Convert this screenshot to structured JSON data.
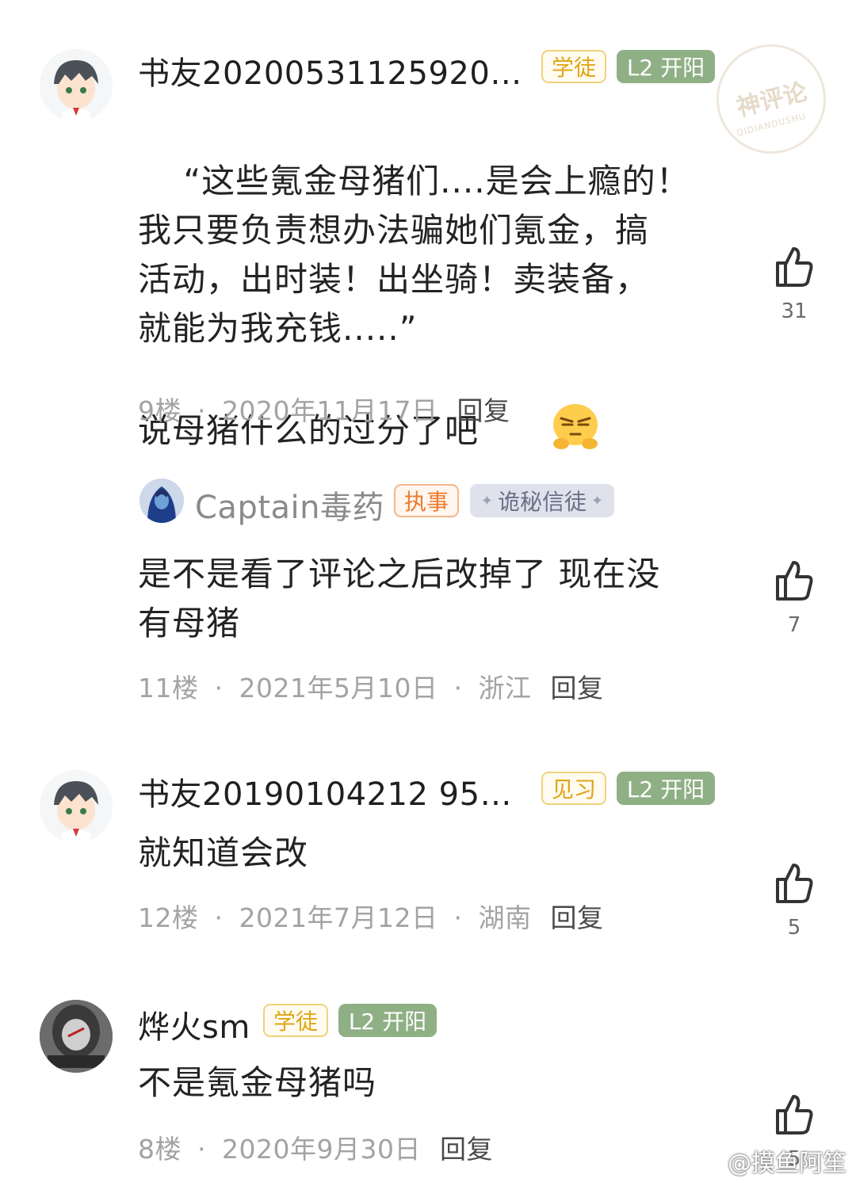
{
  "comments": [
    {
      "username": "书友20200531125920…",
      "badges": [
        "学徒",
        "L2 开阳"
      ],
      "text": "“这些氪金母猪们....是会上瘾的！\n我只要负责想办法骗她们氪金，搞\n活动，出时装！出坐骑！卖装备，\n就能为我充钱.....”\n说母猪什么的过分了吧",
      "floor": "9楼",
      "date": "2020年11月17日",
      "reply": "回复",
      "likes": "31"
    },
    {
      "username": "Captain毒药",
      "badges": [
        "执事",
        "诡秘信徒"
      ],
      "text": "是不是看了评论之后改掉了 现在没\n有母猪",
      "floor": "11楼",
      "date": "2021年5月10日",
      "location": "浙江",
      "reply": "回复",
      "likes": "7"
    },
    {
      "username": "书友20190104212 95…",
      "badges": [
        "见习",
        "L2 开阳"
      ],
      "text": "就知道会改",
      "floor": "12楼",
      "date": "2021年7月12日",
      "location": "湖南",
      "reply": "回复",
      "likes": "5"
    },
    {
      "username": "烨火sm",
      "badges": [
        "学徒",
        "L2 开阳"
      ],
      "text": "不是氪金母猪吗",
      "floor": "8楼",
      "date": "2020年9月30日",
      "reply": "回复",
      "likes": "5"
    }
  ],
  "stamp": {
    "title": "神评论",
    "subtitle": "QIDIANDUSHU"
  },
  "watermark": "@摸鱼阿笙",
  "colors": {
    "gold_badge": "#e0a516",
    "green_badge": "#8faf85",
    "orange_badge": "#ee7a2c",
    "meta": "#a3a3a3"
  },
  "icons": {
    "like": "thumbs-up-icon",
    "emoji": "smirk-emoji-icon"
  }
}
